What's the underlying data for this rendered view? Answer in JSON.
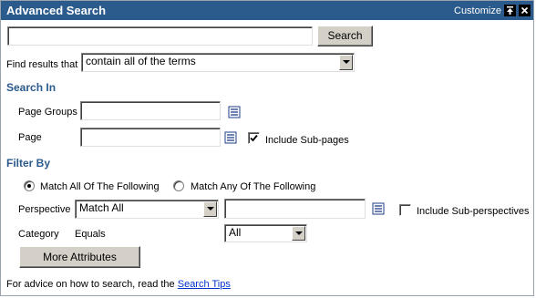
{
  "header": {
    "title": "Advanced Search",
    "customize_label": "Customize",
    "pin_icon": "pin-top-icon",
    "close_icon": "close-icon",
    "bg_color": "#2b5a8c"
  },
  "search": {
    "query_value": "",
    "search_button_label": "Search",
    "find_results_label": "Find results that",
    "find_results_selected": "contain all of the terms"
  },
  "search_in": {
    "heading": "Search In",
    "page_groups_label": "Page Groups",
    "page_groups_value": "",
    "page_label": "Page",
    "page_value": "",
    "include_subpages_label": "Include Sub-pages",
    "include_subpages_checked": true
  },
  "filter_by": {
    "heading": "Filter By",
    "match_all_label": "Match All Of The Following",
    "match_any_label": "Match Any Of The Following",
    "selected_match": "all",
    "perspective_label": "Perspective",
    "perspective_selected": "Match All",
    "perspective_value": "",
    "include_subperspectives_label": "Include Sub-perspectives",
    "include_subperspectives_checked": false,
    "category_label": "Category",
    "category_operator": "Equals",
    "category_selected": "All",
    "more_attributes_label": "More Attributes"
  },
  "footer": {
    "advice_text": "For advice on how to search, read the",
    "tips_link": "Search Tips"
  }
}
